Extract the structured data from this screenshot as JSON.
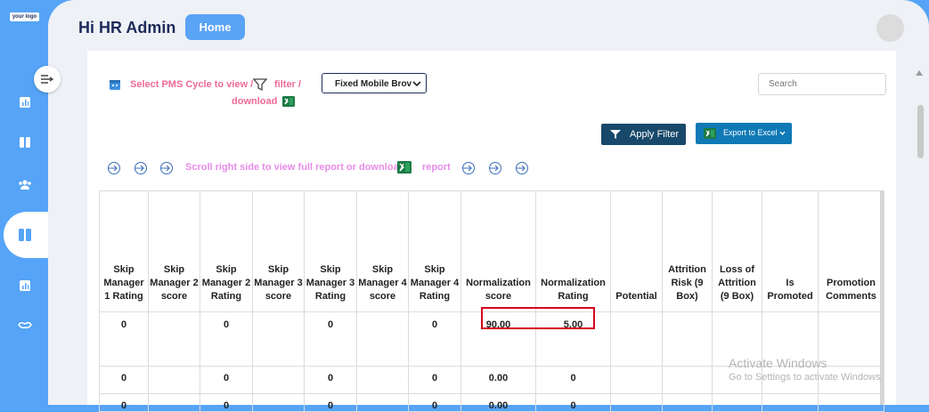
{
  "sidebar": {
    "logo_text": "your logo"
  },
  "header": {
    "greeting": "Hi HR Admin",
    "home_label": "Home"
  },
  "filters": {
    "pms_text": "Select PMS Cycle to view /",
    "filter_text": "filter /",
    "download_text": "download",
    "select_value": "Fixed Mobile Brov",
    "search_placeholder": "Search",
    "apply_label": "Apply Filter",
    "export_label": "Export to Excel"
  },
  "hint": {
    "scroll_text": "Scroll right side to view full report or download",
    "report_text": "report"
  },
  "table": {
    "columns": [
      "Skip Manager 1 Rating",
      "Skip Manager 2 score",
      "Skip Manager 2 Rating",
      "Skip Manager 3 score",
      "Skip Manager 3 Rating",
      "Skip Manager 4 score",
      "Skip Manager 4 Rating",
      "Normalization score",
      "Normalization Rating",
      "Potential",
      "Attrition Risk (9 Box)",
      "Loss of Attrition (9 Box)",
      "Is Promoted",
      "Promotion Comments"
    ],
    "rows": [
      [
        "0",
        "",
        "0",
        "",
        "0",
        "",
        "0",
        "90.00",
        "5.00",
        "",
        "",
        "",
        "",
        ""
      ],
      [
        "0",
        "",
        "0",
        "",
        "0",
        "",
        "0",
        "0.00",
        "0",
        "",
        "",
        "",
        "",
        ""
      ],
      [
        "0",
        "",
        "0",
        "",
        "0",
        "",
        "0",
        "0.00",
        "0",
        "",
        "",
        "",
        "",
        ""
      ]
    ]
  },
  "watermark": {
    "line1": "Activate Windows",
    "line2": "Go to Settings to activate Windows."
  }
}
